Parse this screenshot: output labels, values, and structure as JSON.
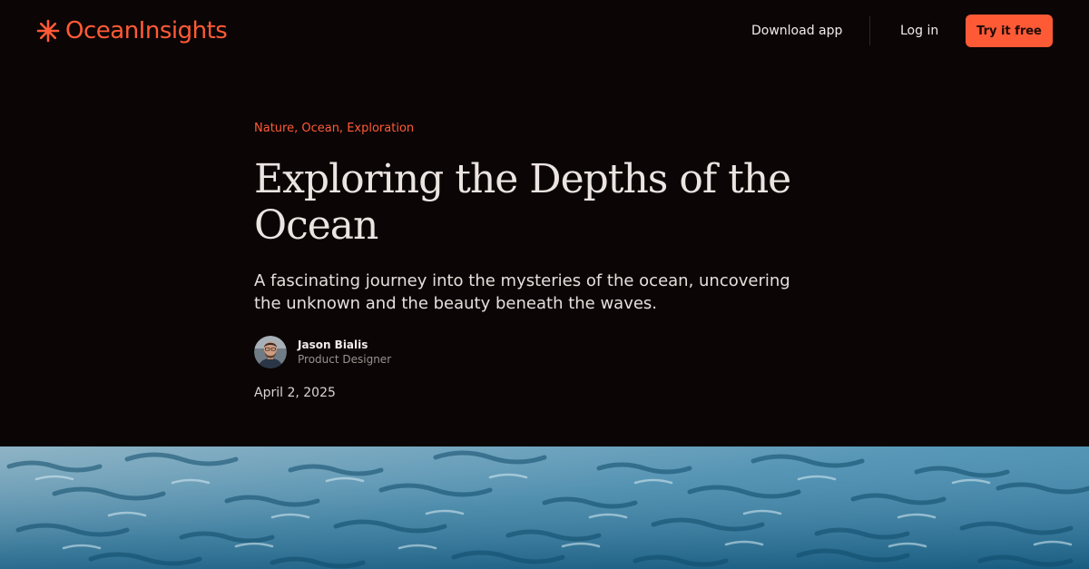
{
  "header": {
    "logo_text": "OceanInsights",
    "nav": {
      "download_label": "Download app",
      "login_label": "Log in",
      "cta_label": "Try it free"
    }
  },
  "article": {
    "tags": "Nature, Ocean, Exploration",
    "title": "Exploring the Depths of the Ocean",
    "subtitle": "A fascinating journey into the mysteries of the ocean, uncovering the unknown and the beauty beneath the waves.",
    "author": {
      "name": "Jason Bialis",
      "role": "Product Designer"
    },
    "date": "April 2, 2025"
  },
  "icons": {
    "logo": "asterisk-icon",
    "avatar": "avatar-photo"
  },
  "colors": {
    "background": "#0b0505",
    "accent": "#ff5a36",
    "text": "#ece4e1",
    "muted": "#9a918e"
  }
}
